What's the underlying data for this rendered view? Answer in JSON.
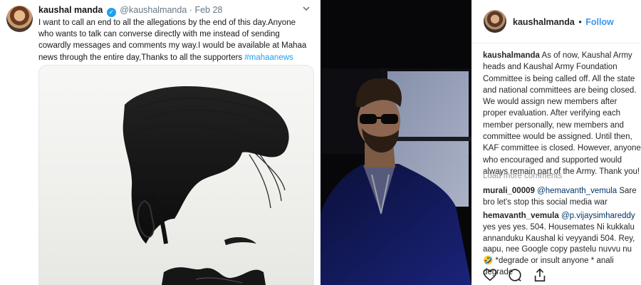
{
  "tweet": {
    "display_name": "kaushal manda",
    "handle": "@kaushalmanda",
    "separator": "·",
    "date": "Feb 28",
    "text": "I want to call an end to all the allegations by the end of this day.Anyone who wants to talk can converse directly with me instead of sending cowardly messages and comments my way.I would be available at Mahaa news through the entire day,Thanks to all the supporters ",
    "hashtag": "#mahaanews",
    "icons": {
      "verified": "verified-badge-icon",
      "menu": "chevron-down-icon"
    },
    "colors": {
      "link": "#1da1f2",
      "text": "#14171a",
      "muted": "#657786"
    }
  },
  "instagram": {
    "username": "kaushalmanda",
    "separator": "•",
    "follow_label": "Follow",
    "caption": "As of now, Kaushal Army heads and Kaushal Army Foundation Committee is being called off. All the state and national committees are being closed. We would assign new members after proper evaluation. After verifying each member personally, new members and committee would be assigned. Until then, KAF committee is closed. However, anyone who encouraged and supported would always remain part of the Army. Thank you!",
    "load_more": "Load more comments",
    "comments": [
      {
        "user": "murali_00009",
        "mention": "@hemavanth_vemula",
        "text": " Sare bro let's stop this social media war"
      },
      {
        "user": "hemavanth_vemula",
        "mention": "@p.vijaysimhareddy",
        "text": " yes yes yes. 504. Housemates Ni kukkalu annanduku Kaushal ki veyyandi 504. Rey, aapu, nee Google copy pastelu nuvvu nu🤣 *degrade or insult anyone * anali degrade"
      }
    ],
    "icons": [
      "heart-icon",
      "comment-icon",
      "share-icon"
    ],
    "colors": {
      "follow": "#3897f0",
      "mention": "#003569",
      "muted": "#999999"
    }
  }
}
